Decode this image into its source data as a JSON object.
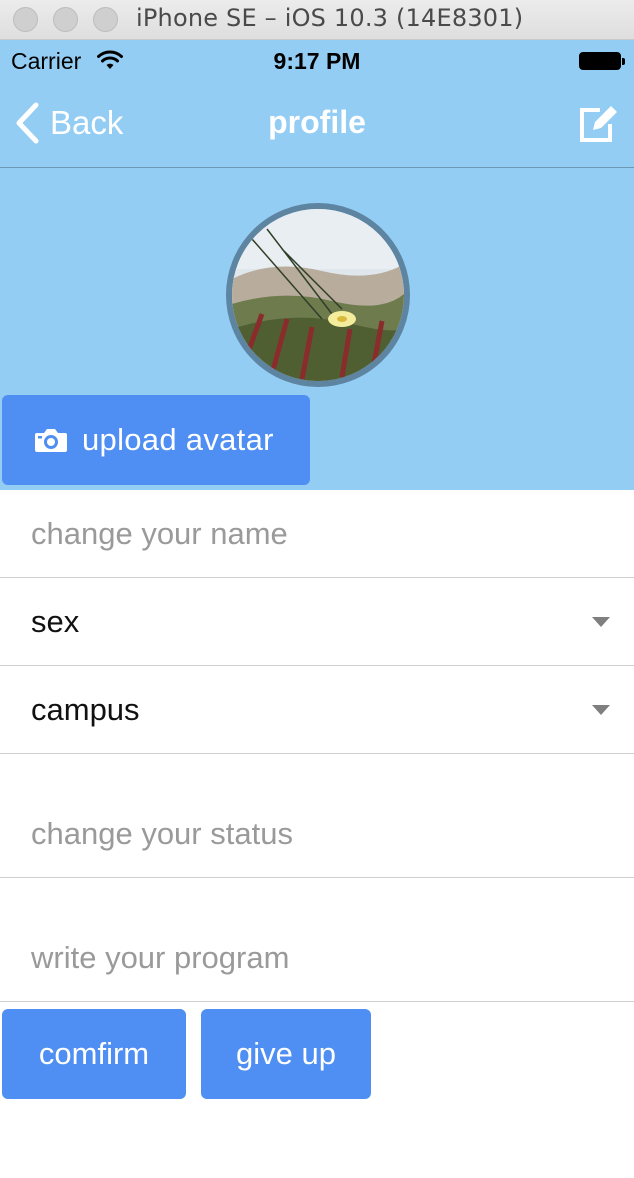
{
  "simulator": {
    "title": "iPhone SE – iOS 10.3 (14E8301)"
  },
  "statusbar": {
    "carrier": "Carrier",
    "time": "9:17 PM"
  },
  "navbar": {
    "back_label": "Back",
    "title": "profile"
  },
  "profile": {
    "upload_label": "upload avatar"
  },
  "form": {
    "name_placeholder": "change your name",
    "sex_label": "sex",
    "campus_label": "campus",
    "status_placeholder": "change your status",
    "program_placeholder": "write your program"
  },
  "actions": {
    "confirm_label": "comfirm",
    "give_up_label": "give up"
  },
  "icons": [
    "wifi-icon",
    "battery-icon",
    "chevron-left-icon",
    "edit-icon",
    "camera-icon",
    "caret-down-icon"
  ],
  "colors": {
    "header_bg": "#94cdf3",
    "button_bg": "#4f8ef2",
    "placeholder": "#9a9a9a"
  }
}
